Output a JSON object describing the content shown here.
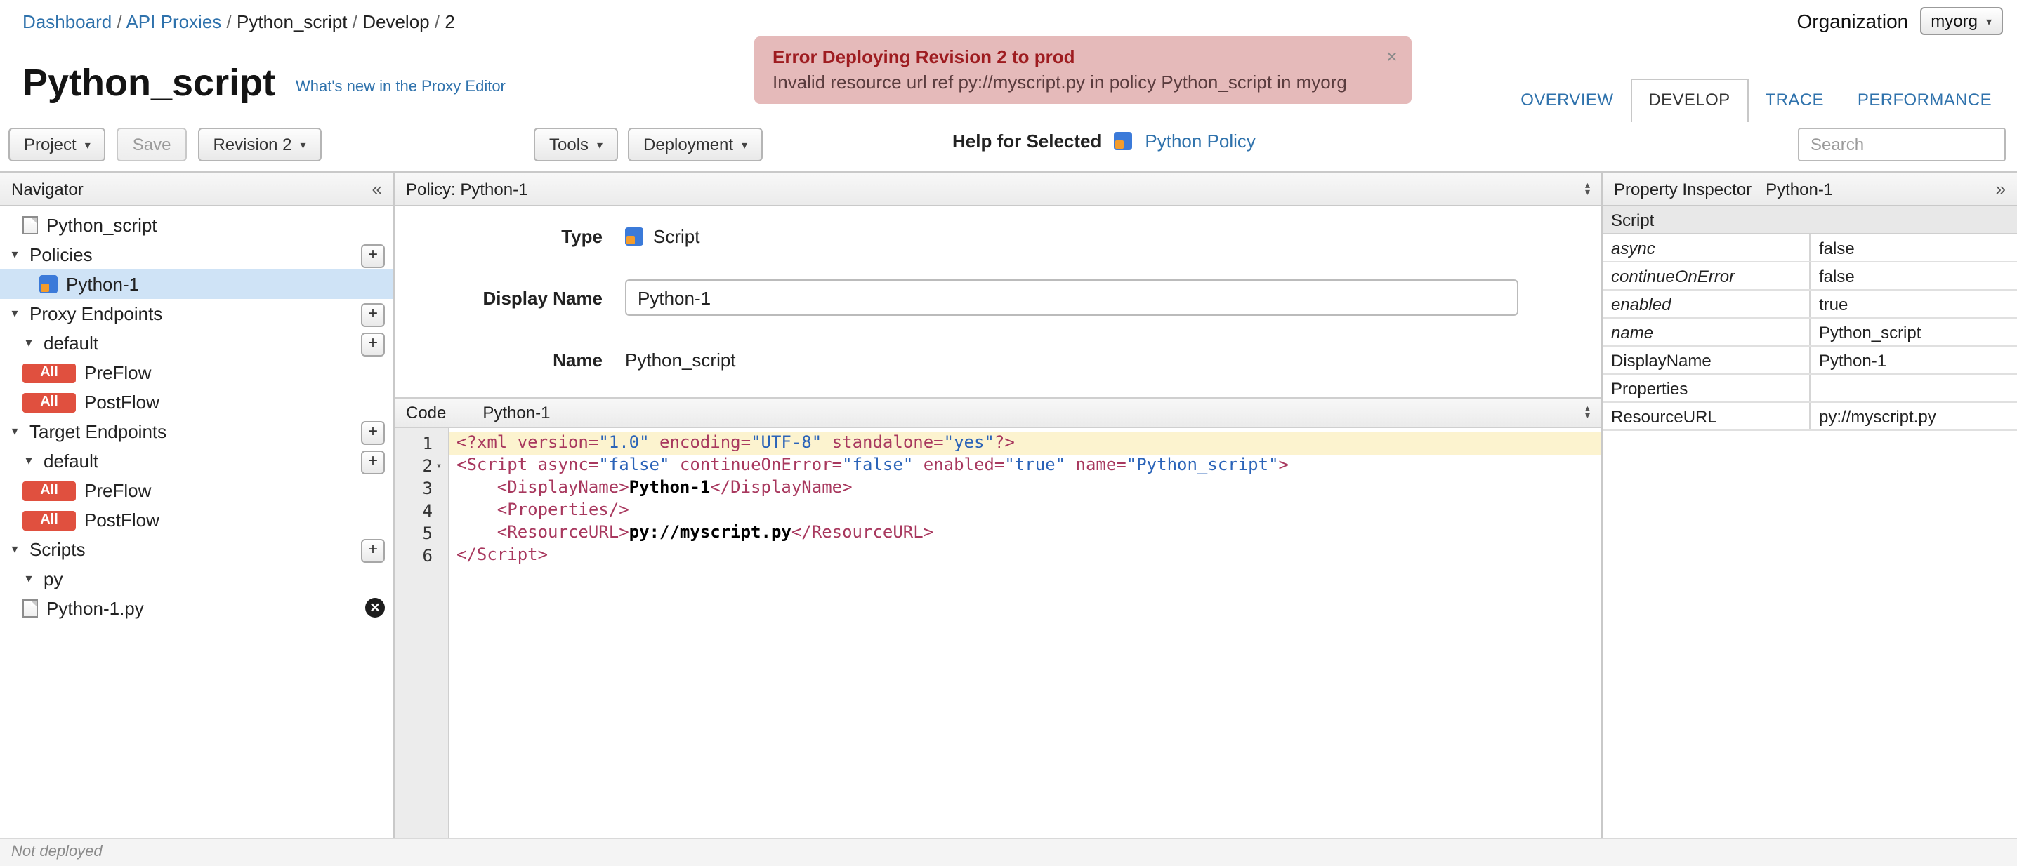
{
  "breadcrumb": {
    "items": [
      {
        "label": "Dashboard",
        "link": true
      },
      {
        "label": "API Proxies",
        "link": true
      },
      {
        "label": "Python_script",
        "link": false
      },
      {
        "label": "Develop",
        "link": false
      },
      {
        "label": "2",
        "link": false
      }
    ]
  },
  "organization": {
    "label": "Organization",
    "value": "myorg"
  },
  "error_banner": {
    "title": "Error Deploying Revision 2 to prod",
    "message": "Invalid resource url ref py://myscript.py in policy Python_script in myorg",
    "close": "×"
  },
  "header": {
    "title": "Python_script",
    "whats_new": "What's new in the Proxy Editor"
  },
  "tabs": {
    "items": [
      {
        "label": "OVERVIEW",
        "active": false
      },
      {
        "label": "DEVELOP",
        "active": true
      },
      {
        "label": "TRACE",
        "active": false
      },
      {
        "label": "PERFORMANCE",
        "active": false
      }
    ]
  },
  "toolbar": {
    "project": "Project",
    "save": "Save",
    "revision": "Revision 2",
    "tools": "Tools",
    "deployment": "Deployment",
    "help_for_selected": "Help for Selected",
    "policy_link": "Python Policy",
    "search_placeholder": "Search"
  },
  "navigator": {
    "title": "Navigator",
    "collapse_icon": "«",
    "items": [
      {
        "label": "Python_script",
        "kind": "file",
        "icon": "doc",
        "level": 1
      },
      {
        "label": "Policies",
        "kind": "section",
        "caret": true,
        "add": true,
        "level": 0
      },
      {
        "label": "Python-1",
        "kind": "policy",
        "icon": "policy",
        "selected": true,
        "level": 2
      },
      {
        "label": "Proxy Endpoints",
        "kind": "section",
        "caret": true,
        "add": true,
        "level": 0
      },
      {
        "label": "default",
        "kind": "section",
        "caret": true,
        "add": true,
        "level": 1
      },
      {
        "label": "PreFlow",
        "kind": "flow",
        "badge": "All",
        "level": 1
      },
      {
        "label": "PostFlow",
        "kind": "flow",
        "badge": "All",
        "level": 1
      },
      {
        "label": "Target Endpoints",
        "kind": "section",
        "caret": true,
        "add": true,
        "level": 0
      },
      {
        "label": "default",
        "kind": "section",
        "caret": true,
        "add": true,
        "level": 1
      },
      {
        "label": "PreFlow",
        "kind": "flow",
        "badge": "All",
        "level": 1
      },
      {
        "label": "PostFlow",
        "kind": "flow",
        "badge": "All",
        "level": 1
      },
      {
        "label": "Scripts",
        "kind": "section",
        "caret": true,
        "add": true,
        "level": 0
      },
      {
        "label": "py",
        "kind": "folder",
        "caret": true,
        "level": 1
      },
      {
        "label": "Python-1.py",
        "kind": "file",
        "icon": "doc",
        "removable": true,
        "level": 1
      }
    ]
  },
  "center": {
    "panel_title": "Policy: Python-1",
    "form": {
      "type_label": "Type",
      "type_value": "Script",
      "display_name_label": "Display Name",
      "display_name_value": "Python-1",
      "name_label": "Name",
      "name_value": "Python_script"
    },
    "code": {
      "header_label": "Code",
      "header_file": "Python-1",
      "active_line": 1,
      "fold_line": 2,
      "lines": [
        [
          [
            "<?xml version=",
            "t"
          ],
          [
            "\"1.0\"",
            "s"
          ],
          [
            " encoding=",
            "t"
          ],
          [
            "\"UTF-8\"",
            "s"
          ],
          [
            " standalone=",
            "t"
          ],
          [
            "\"yes\"",
            "s"
          ],
          [
            "?>",
            "t"
          ]
        ],
        [
          [
            "<Script async=",
            "t"
          ],
          [
            "\"false\"",
            "s"
          ],
          [
            " continueOnError=",
            "t"
          ],
          [
            "\"false\"",
            "s"
          ],
          [
            " enabled=",
            "t"
          ],
          [
            "\"true\"",
            "s"
          ],
          [
            " name=",
            "t"
          ],
          [
            "\"Python_script\"",
            "s"
          ],
          [
            ">",
            "t"
          ]
        ],
        [
          [
            "    <DisplayName>",
            "t"
          ],
          [
            "Python-1",
            "b"
          ],
          [
            "</DisplayName>",
            "t"
          ]
        ],
        [
          [
            "    <Properties/>",
            "t"
          ]
        ],
        [
          [
            "    <ResourceURL>",
            "t"
          ],
          [
            "py://myscript.py",
            "b"
          ],
          [
            "</ResourceURL>",
            "t"
          ]
        ],
        [
          [
            "</Script>",
            "t"
          ]
        ]
      ]
    }
  },
  "inspector": {
    "title": "Property Inspector",
    "subtitle": "Python-1",
    "expand_icon": "»",
    "rows": [
      {
        "name": "Script",
        "header": true
      },
      {
        "name": "async",
        "value": "false",
        "italic": true
      },
      {
        "name": "continueOnError",
        "value": "false",
        "italic": true
      },
      {
        "name": "enabled",
        "value": "true",
        "italic": true
      },
      {
        "name": "name",
        "value": "Python_script",
        "italic": true
      },
      {
        "name": "DisplayName",
        "value": "Python-1",
        "italic": false
      },
      {
        "name": "Properties",
        "value": "",
        "italic": false
      },
      {
        "name": "ResourceURL",
        "value": "py://myscript.py",
        "italic": false
      }
    ]
  },
  "statusbar": {
    "text": "Not deployed"
  },
  "colors": {
    "link": "#2f72ac",
    "badge_all": "#e0503f",
    "error_bg": "#e5baba",
    "error_title": "#9e1c20",
    "selected_row": "#cfe3f6",
    "code_tag": "#a8385e",
    "code_string": "#2a63b8",
    "active_line_bg": "#fcf3cf"
  }
}
